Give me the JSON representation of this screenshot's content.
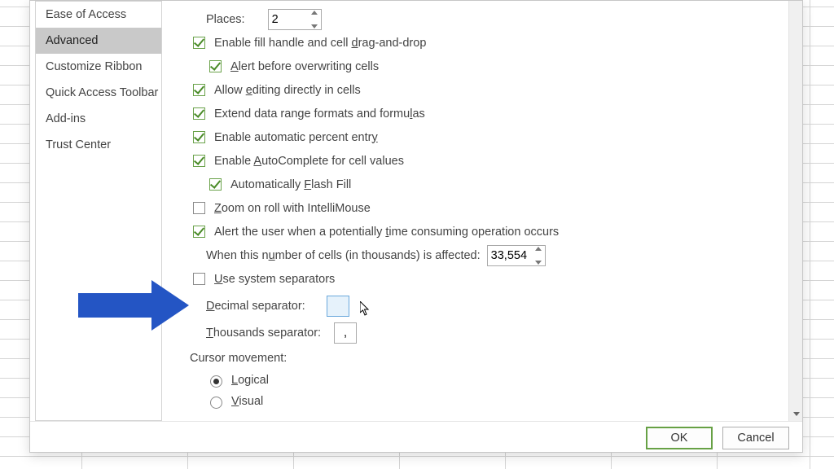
{
  "sidebar": {
    "items": [
      {
        "label": "Ease of Access"
      },
      {
        "label": "Advanced"
      },
      {
        "label": "Customize Ribbon"
      },
      {
        "label": "Quick Access Toolbar"
      },
      {
        "label": "Add-ins"
      },
      {
        "label": "Trust Center"
      }
    ],
    "selected_index": 1
  },
  "options": {
    "places_label": "Places:",
    "places_value": "2",
    "fill_handle": "Enable fill handle and cell drag-and-drop",
    "alert_overwrite": "Alert before overwriting cells",
    "allow_edit": "Allow editing directly in cells",
    "extend_formats": "Extend data range formats and formulas",
    "auto_percent": "Enable automatic percent entry",
    "autocomplete": "Enable AutoComplete for cell values",
    "flash_fill": "Automatically Flash Fill",
    "zoom_intellimouse": "Zoom on roll with IntelliMouse",
    "alert_time_consuming": "Alert the user when a potentially time consuming operation occurs",
    "cells_affected_label": "When this number of cells (in thousands) is affected:",
    "cells_affected_value": "33,554",
    "system_separators": "Use system separators",
    "decimal_sep_label": "Decimal separator:",
    "decimal_sep_value": "",
    "thousands_sep_label": "Thousands separator:",
    "thousands_sep_value": ",",
    "cursor_movement_label": "Cursor movement:",
    "cursor_logical": "Logical",
    "cursor_visual": "Visual"
  },
  "buttons": {
    "ok": "OK",
    "cancel": "Cancel"
  }
}
